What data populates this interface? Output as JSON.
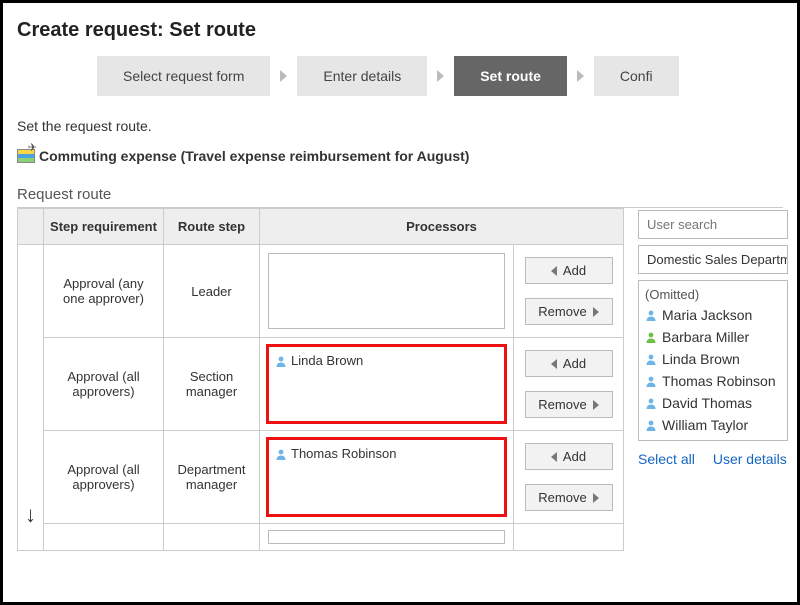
{
  "title": "Create request: Set route",
  "steps": {
    "s1": "Select request form",
    "s2": "Enter details",
    "s3": "Set route",
    "s4": "Confi"
  },
  "instruction": "Set the request route.",
  "expense_title": "Commuting expense (Travel expense reimbursement for August)",
  "section_label": "Request route",
  "headers": {
    "req": "Step requirement",
    "step": "Route step",
    "proc": "Processors"
  },
  "rows": [
    {
      "req": "Approval (any one approver)",
      "step": "Leader",
      "processors": []
    },
    {
      "req": "Approval (all approvers)",
      "step": "Section manager",
      "processors": [
        "Linda Brown"
      ]
    },
    {
      "req": "Approval (all approvers)",
      "step": "Department manager",
      "processors": [
        "Thomas Robinson"
      ]
    }
  ],
  "buttons": {
    "add": "Add",
    "remove": "Remove"
  },
  "side": {
    "search_placeholder": "User search",
    "dept": "Domestic Sales Departm",
    "omitted": "(Omitted)",
    "users": [
      {
        "name": "Maria Jackson",
        "color": "blue"
      },
      {
        "name": "Barbara Miller",
        "color": "green"
      },
      {
        "name": "Linda Brown",
        "color": "blue"
      },
      {
        "name": "Thomas Robinson",
        "color": "blue"
      },
      {
        "name": "David Thomas",
        "color": "blue"
      },
      {
        "name": "William Taylor",
        "color": "blue"
      }
    ],
    "select_all": "Select all",
    "user_details": "User details"
  }
}
